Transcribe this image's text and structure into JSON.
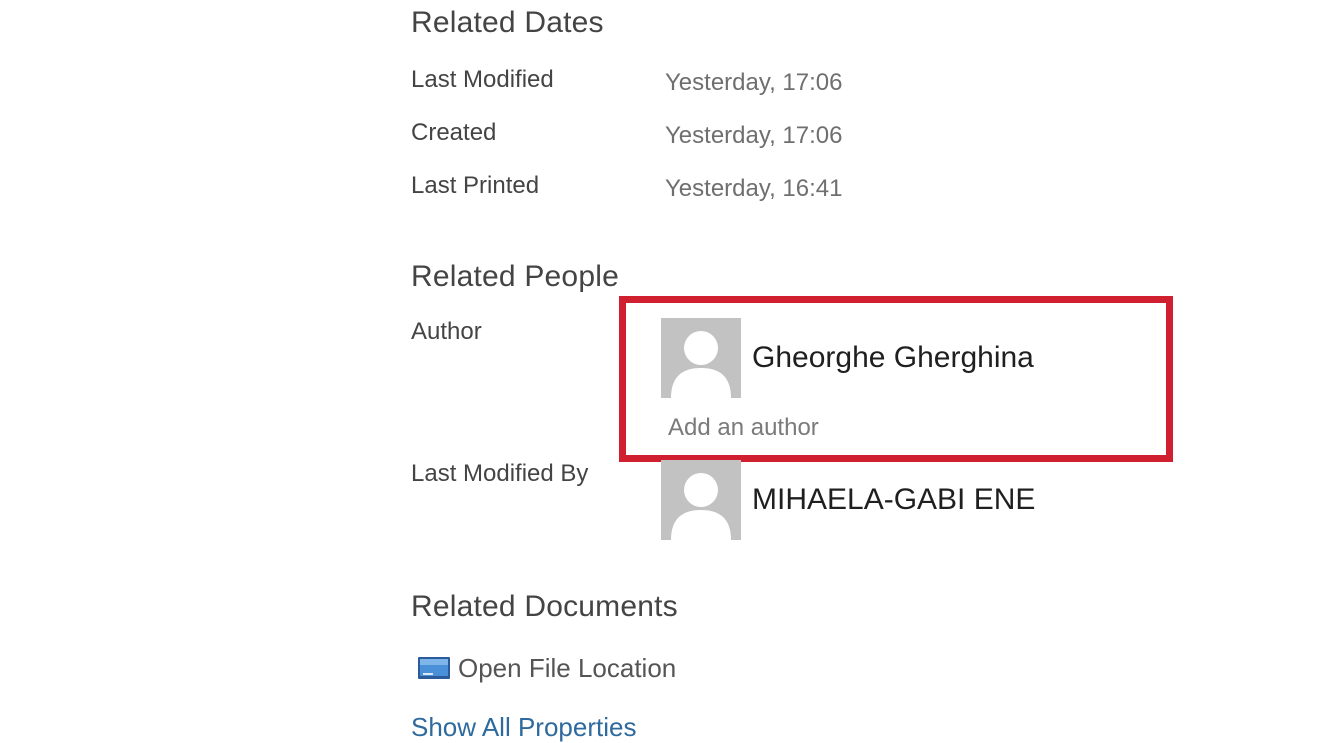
{
  "related_dates": {
    "title": "Related Dates",
    "rows": [
      {
        "label": "Last Modified",
        "value": "Yesterday, 17:06"
      },
      {
        "label": "Created",
        "value": "Yesterday, 17:06"
      },
      {
        "label": "Last Printed",
        "value": "Yesterday, 16:41"
      }
    ]
  },
  "related_people": {
    "title": "Related People",
    "author": {
      "label": "Author",
      "name": "Gheorghe Gherghina",
      "add_author": "Add an author"
    },
    "last_modified_by": {
      "label": "Last Modified By",
      "name": "MIHAELA-GABI ENE"
    }
  },
  "related_documents": {
    "title": "Related Documents",
    "open_file_location": "Open File Location"
  },
  "show_all_properties": "Show All Properties",
  "colors": {
    "highlight": "#d0202f",
    "link": "#2e6a9e",
    "avatar_bg": "#c2c2c2"
  },
  "icons": {
    "avatar": "person-placeholder-icon",
    "open_file_location": "folder-icon"
  }
}
